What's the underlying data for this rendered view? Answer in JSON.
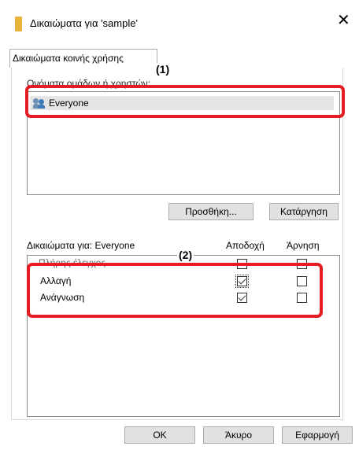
{
  "window": {
    "title": "Δικαιώματα για 'sample'"
  },
  "tabs": [
    {
      "label": "Δικαιώματα κοινής χρήσης"
    }
  ],
  "group": {
    "label": "Ονόματα ομάδων ή χρηστών:"
  },
  "users": [
    {
      "name": "Everyone"
    }
  ],
  "user_buttons": {
    "add": "Προσθήκη...",
    "remove": "Κατάργηση"
  },
  "permissions": {
    "header_label": "Δικαιώματα για: Everyone",
    "allow_col": "Αποδοχή",
    "deny_col": "Άρνηση",
    "rows": [
      {
        "name": "Πλήρης έλεγχος",
        "allow": false,
        "deny": false
      },
      {
        "name": "Αλλαγή",
        "allow": true,
        "deny": false
      },
      {
        "name": "Ανάγνωση",
        "allow": true,
        "deny": false
      }
    ]
  },
  "annotations": {
    "one": "(1)",
    "two": "(2)"
  },
  "footer": {
    "ok": "OK",
    "cancel": "Άκυρο",
    "apply": "Εφαρμογή"
  },
  "colors": {
    "annotation": "#e51c23",
    "folder": "#e8b33a",
    "selected_row": "#e5e5e5"
  }
}
